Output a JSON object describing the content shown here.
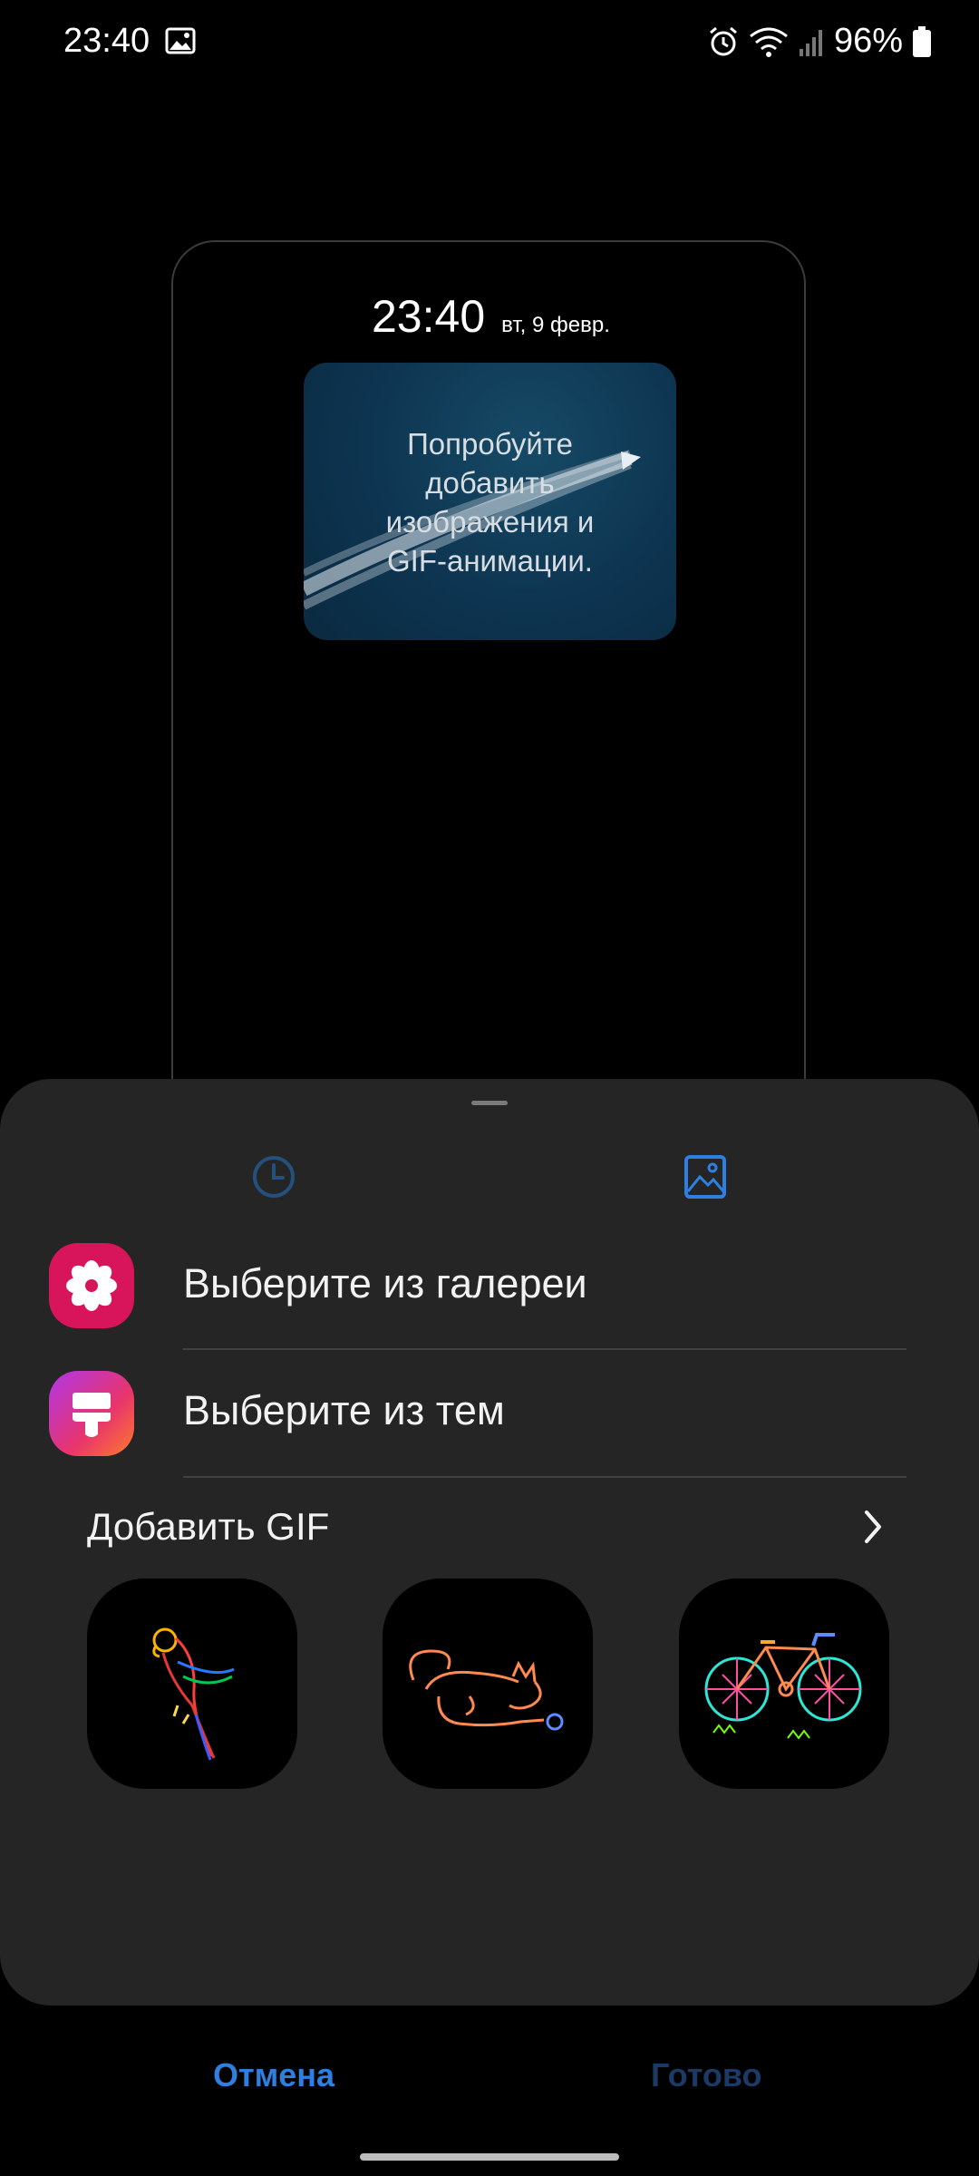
{
  "status_bar": {
    "time": "23:40",
    "battery": "96%"
  },
  "preview": {
    "time": "23:40",
    "date": "вт, 9 февр.",
    "widget_text": "Попробуйте\nдобавить\nизображения и\nGIF-анимации."
  },
  "sheet": {
    "tabs": [
      {
        "icon": "clock-icon",
        "selected": false
      },
      {
        "icon": "image-icon",
        "selected": true
      }
    ],
    "options": [
      {
        "label": "Выберите из галереи",
        "icon": "gallery-flower-icon",
        "color": "#d8155a"
      },
      {
        "label": "Выберите из тем",
        "icon": "themes-brush-icon",
        "color": "#b036e8"
      }
    ],
    "gif_section": {
      "title": "Добавить GIF",
      "items": [
        {
          "name": "parrot-gif"
        },
        {
          "name": "cat-gif"
        },
        {
          "name": "bicycle-gif"
        }
      ]
    }
  },
  "buttons": {
    "cancel": "Отмена",
    "done": "Готово"
  },
  "colors": {
    "accent": "#2f7fe0",
    "sheet_bg": "#252525"
  }
}
